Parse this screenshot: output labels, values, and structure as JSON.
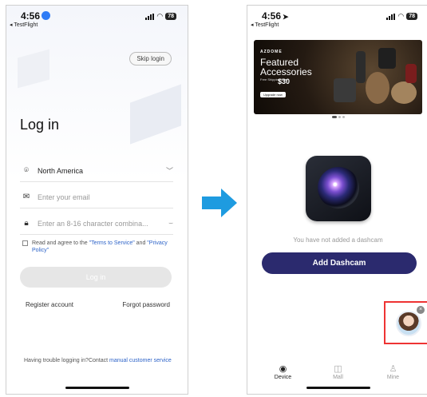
{
  "left": {
    "status": {
      "time": "4:56",
      "back_app": "◂ TestFlight",
      "battery": "78"
    },
    "skip_label": "Skip login",
    "title": "Log in",
    "region": "North America",
    "email_placeholder": "Enter your email",
    "password_placeholder": "Enter an 8-16 character combina...",
    "agree": {
      "prefix": "Read and agree to the ",
      "terms": "\"Terms to Service\"",
      "and": " and ",
      "privacy": "\"Privacy Policy\""
    },
    "login_label": "Log in",
    "register_label": "Register account",
    "forgot_label": "Forgot password",
    "trouble": {
      "text": "Having trouble logging in?Contact ",
      "link": "manual customer service"
    }
  },
  "right": {
    "status": {
      "time": "4:56",
      "back_app": "◂ TestFlight",
      "battery": "78"
    },
    "banner": {
      "brand": "AZDOME",
      "title_line1": "Featured",
      "title_line2": "Accessories",
      "free_shipping": "Free Shipping Over",
      "price": "$30",
      "cta": "Upgrade now"
    },
    "empty_message": "You have not added a dashcam",
    "add_label": "Add Dashcam",
    "tabs": [
      {
        "label": "Device",
        "icon": "record-icon"
      },
      {
        "label": "Mall",
        "icon": "shopping-bag-icon"
      },
      {
        "label": "Mine",
        "icon": "person-icon"
      }
    ]
  },
  "colors": {
    "primary": "#2b2a6e",
    "link": "#2d63c8",
    "highlight": "#e33333",
    "arrow": "#1e9be0"
  }
}
